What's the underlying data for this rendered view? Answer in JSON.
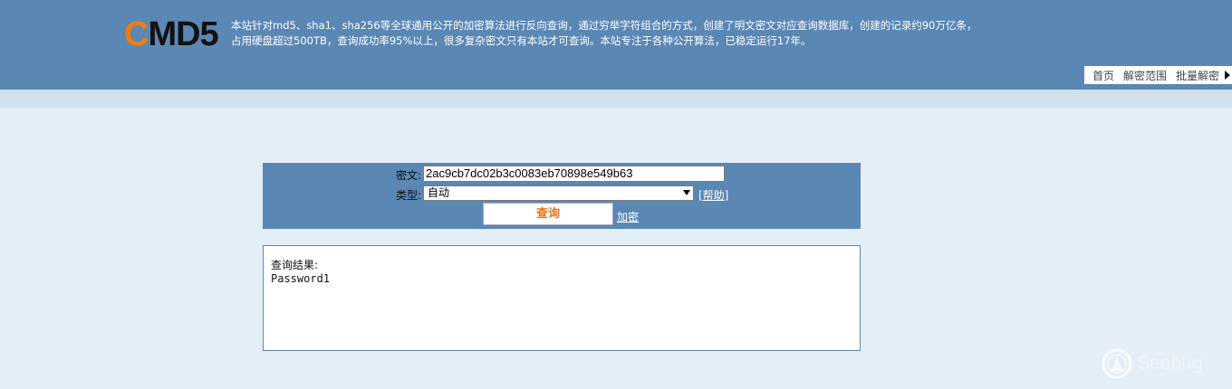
{
  "header": {
    "logo": {
      "first_letter": "C",
      "rest": "MD5"
    },
    "tagline_line1": "本站针对md5、sha1、sha256等全球通用公开的加密算法进行反向查询，通过穷举字符组合的方式，创建了明文密文对应查询数据库，创建的记录约90万亿条，",
    "tagline_line2": "占用硬盘超过500TB，查询成功率95%以上，很多复杂密文只有本站才可查询。本站专注于各种公开算法，已稳定运行17年。",
    "nav": [
      {
        "label": "首页"
      },
      {
        "label": "解密范围"
      },
      {
        "label": "批量解密"
      }
    ]
  },
  "form": {
    "cipher_label": "密文:",
    "cipher_value": "2ac9cb7dc02b3c0083eb70898e549b63",
    "type_label": "类型:",
    "type_selected": "自动",
    "help_label": "[帮助]",
    "query_button": "查询",
    "encrypt_link": "加密"
  },
  "result": {
    "label": "查询结果:",
    "value": "Password1"
  },
  "watermark": {
    "text": "Seebug"
  }
}
